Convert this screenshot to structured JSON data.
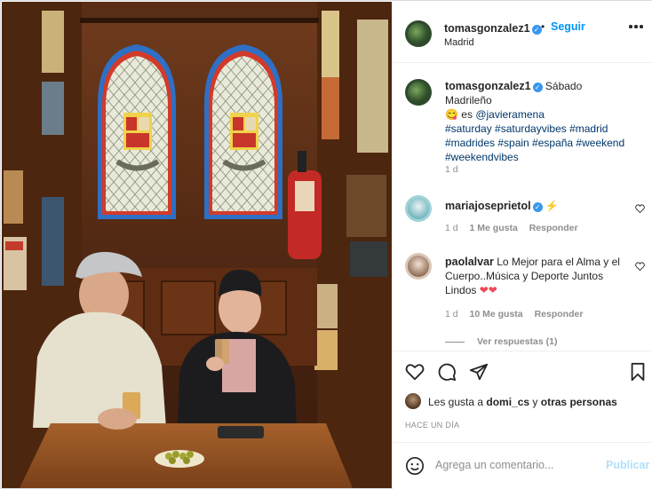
{
  "post": {
    "author": "tomasgonzalez1",
    "follow_label": "Seguir",
    "dot": "•",
    "location": "Madrid",
    "more_icon": "more-horizontal-icon"
  },
  "caption": {
    "author": "tomasgonzalez1",
    "text_intro": "Sábado Madrileño",
    "emoji": "😋",
    "text_es": "es",
    "mention": "@javieramena",
    "hashtags": "#saturday #saturdayvibes #madrid #madrides #spain #españa #weekend #weekendvibes",
    "time": "1 d"
  },
  "comments": [
    {
      "author": "mariajoseprietol",
      "text": "⚡",
      "time": "1 d",
      "likes": "1 Me gusta",
      "reply": "Responder"
    },
    {
      "author": "paolalvar",
      "text": "Lo Mejor para el Alma y el Cuerpo..Música y Deporte Juntos Lindos",
      "hearts": "❤❤",
      "time": "1 d",
      "likes": "10 Me gusta",
      "reply": "Responder"
    }
  ],
  "view_replies": "Ver respuestas (1)",
  "likes": {
    "prefix": "Les gusta a",
    "user": "domi_cs",
    "joiner": "y",
    "others": "otras personas"
  },
  "time_ago": "HACE UN DÍA",
  "composer": {
    "placeholder": "Agrega un comentario...",
    "publish": "Publicar"
  },
  "colors": {
    "link_blue": "#0095f6",
    "hashtag": "#00376b",
    "verified": "#3897f0",
    "heart_red": "#ed4956"
  }
}
